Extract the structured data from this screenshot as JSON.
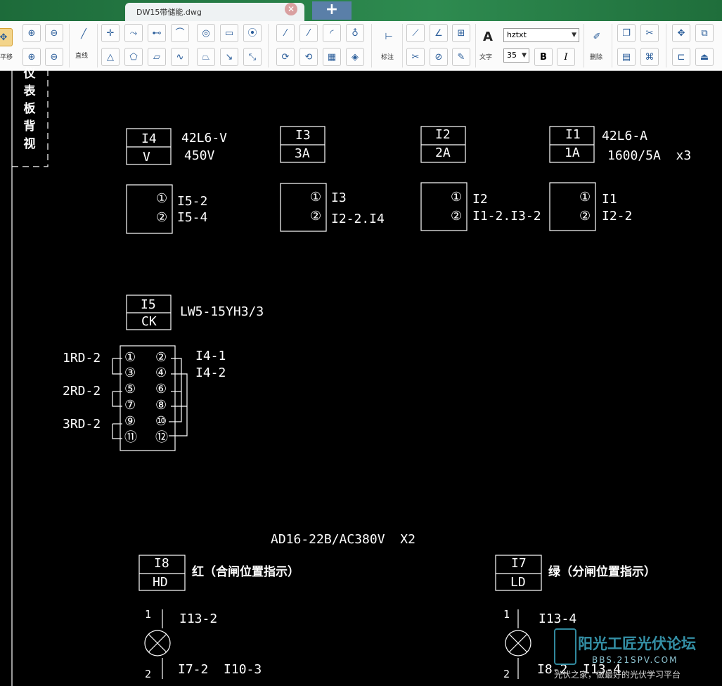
{
  "tab": {
    "filename": "DW15带储能.dwg",
    "close_glyph": "✕",
    "new_glyph": "+"
  },
  "toolbar": {
    "pan_label": "平移",
    "line_label": "直线",
    "dim_label": "标注",
    "text_label": "文字",
    "delete_label": "删除",
    "font_name": "hztxt",
    "font_size": "35",
    "bold": "B",
    "italic": "I",
    "big_a": "A"
  },
  "drawing": {
    "side_label": [
      "仪",
      "表",
      "板",
      "背",
      "视"
    ],
    "i4": {
      "id": "I4",
      "sub": "V",
      "model": "42L6-V",
      "rating": "450V"
    },
    "i3": {
      "id": "I3",
      "sub": "3A"
    },
    "i2": {
      "id": "I2",
      "sub": "2A"
    },
    "i1": {
      "id": "I1",
      "sub": "1A",
      "model": "42L6-A",
      "rating": "1600/5A  x3"
    },
    "meter4": {
      "t1": "①",
      "t2": "②",
      "l1": "I5-2",
      "l2": "I5-4"
    },
    "meter3": {
      "t1": "①",
      "t2": "②",
      "l1": "I3",
      "l2": "I2-2.I4"
    },
    "meter2": {
      "t1": "①",
      "t2": "②",
      "l1": "I2",
      "l2": "I1-2.I3-2"
    },
    "meter1": {
      "t1": "①",
      "t2": "②",
      "l1": "I1",
      "l2": "I2-2"
    },
    "i5": {
      "id": "I5",
      "sub": "CK",
      "model": "LW5-15YH3/3"
    },
    "switch_terms": [
      "①",
      "②",
      "③",
      "④",
      "⑤",
      "⑥",
      "⑦",
      "⑧",
      "⑨",
      "⑩",
      "⑪",
      "⑫"
    ],
    "switch_left": [
      "1RD-2",
      "2RD-2",
      "3RD-2"
    ],
    "switch_right": [
      "I4-1",
      "I4-2"
    ],
    "lamp_model": "AD16-22B/AC380V  X2",
    "i8": {
      "id": "I8",
      "sub": "HD",
      "desc": "红（合闸位置指示）",
      "p1": "1",
      "p2": "2",
      "top": "I13-2",
      "bottom": "I7-2  I10-3"
    },
    "i7": {
      "id": "I7",
      "sub": "LD",
      "desc": "绿（分闸位置指示）",
      "p1": "1",
      "p2": "2",
      "top": "I13-4",
      "bottom": "I8-2  I13-4"
    }
  },
  "watermark": {
    "title": "阳光工匠光伏论坛",
    "url": "BBS.21SPV.COM",
    "slogan": "光伏之家，做最好的光伏学习平台"
  }
}
